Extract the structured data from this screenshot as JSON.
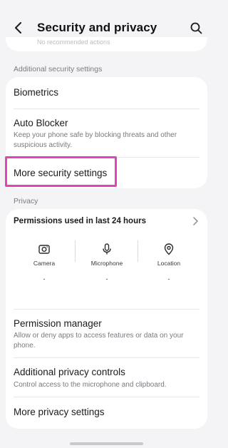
{
  "header": {
    "title": "Security and privacy",
    "back_icon": "chevron-left-icon",
    "search_icon": "search-icon"
  },
  "top_card": {
    "faded_text": "No recommended actions"
  },
  "additional_security": {
    "section_label": "Additional security settings",
    "items": [
      {
        "title": "Biometrics"
      },
      {
        "title": "Auto Blocker",
        "subtitle": "Keep your phone safe by blocking threats and other suspicious activity."
      },
      {
        "title": "More security settings"
      }
    ]
  },
  "privacy": {
    "section_label": "Privacy",
    "permissions_title": "Permissions used in last 24 hours",
    "columns": [
      {
        "label": "Camera",
        "value": "-",
        "icon": "camera-icon"
      },
      {
        "label": "Microphone",
        "value": "-",
        "icon": "microphone-icon"
      },
      {
        "label": "Location",
        "value": "-",
        "icon": "location-icon"
      }
    ],
    "items": [
      {
        "title": "Permission manager",
        "subtitle": "Allow or deny apps to access features or data on your phone."
      },
      {
        "title": "Additional privacy controls",
        "subtitle": "Control access to the microphone and clipboard."
      },
      {
        "title": "More privacy settings"
      }
    ]
  },
  "colors": {
    "highlight": "#e045b5",
    "background": "#f4f4f6",
    "card": "#ffffff"
  }
}
